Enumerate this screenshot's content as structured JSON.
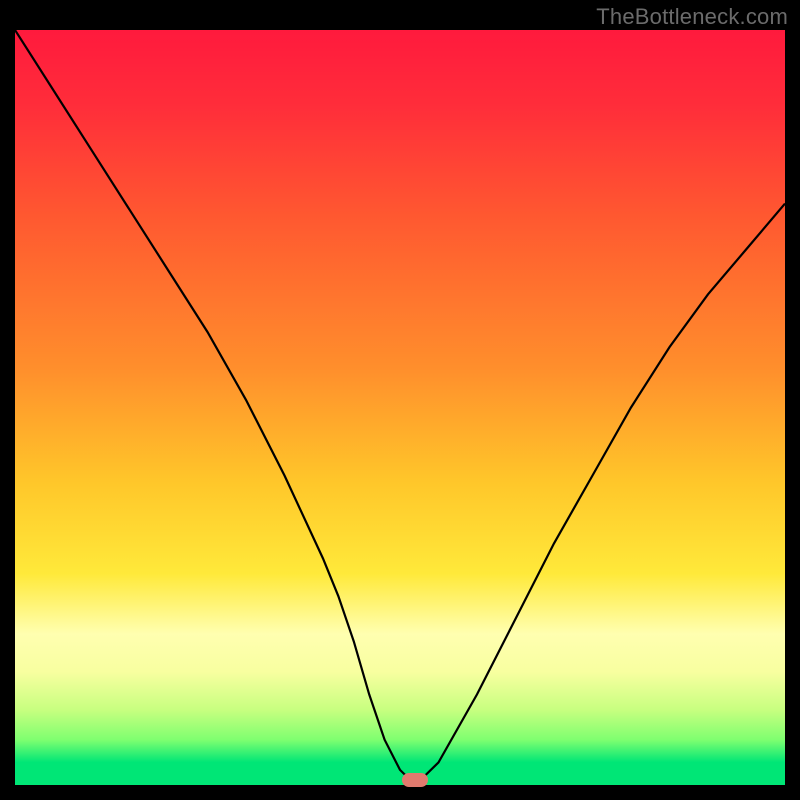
{
  "watermark": "TheBottleneck.com",
  "colors": {
    "curve": "#000000",
    "marker": "#e07a6e"
  },
  "chart_data": {
    "type": "line",
    "title": "",
    "xlabel": "",
    "ylabel": "",
    "x": [
      0,
      5,
      10,
      15,
      20,
      25,
      30,
      35,
      40,
      42,
      44,
      46,
      48,
      50,
      52,
      55,
      60,
      65,
      70,
      75,
      80,
      85,
      90,
      95,
      100
    ],
    "values": [
      100,
      92,
      84,
      76,
      68,
      60,
      51,
      41,
      30,
      25,
      19,
      12,
      6,
      2,
      0,
      3,
      12,
      22,
      32,
      41,
      50,
      58,
      65,
      71,
      77
    ],
    "xlim": [
      0,
      100
    ],
    "ylim": [
      0,
      100
    ],
    "marker": {
      "x": 52,
      "y": 0
    }
  }
}
